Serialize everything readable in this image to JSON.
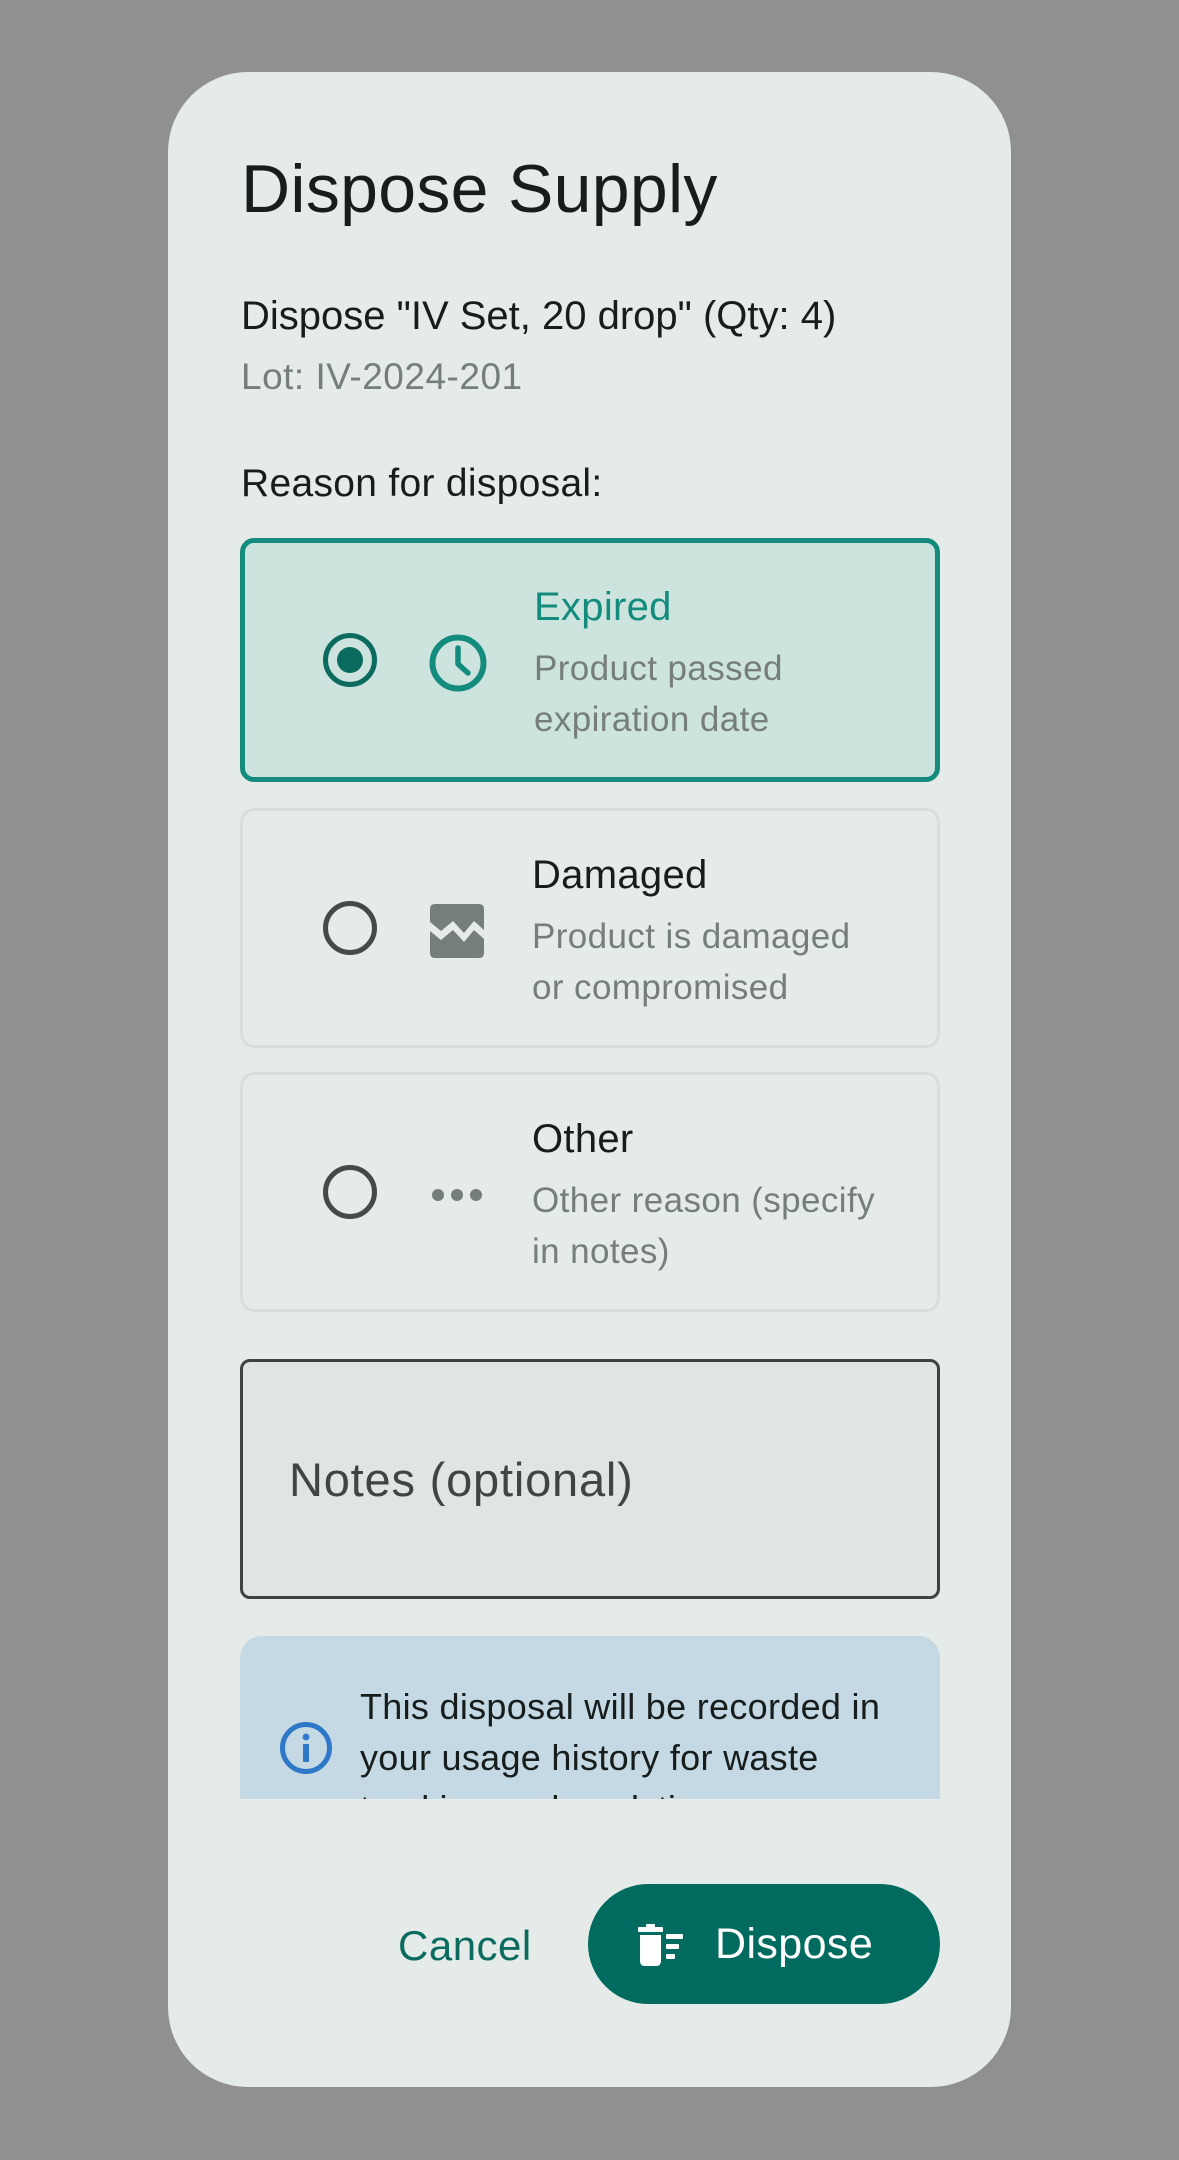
{
  "dialog": {
    "title": "Dispose Supply",
    "subtitle": "Dispose \"IV Set, 20 drop\" (Qty: 4)",
    "lot": "Lot: IV-2024-201",
    "reason_label": "Reason for disposal:"
  },
  "reasons": [
    {
      "title": "Expired",
      "desc": "Product passed expiration date",
      "icon": "clock-icon",
      "selected": true
    },
    {
      "title": "Damaged",
      "desc": "Product is damaged or compromised",
      "icon": "broken-image-icon",
      "selected": false
    },
    {
      "title": "Other",
      "desc": "Other reason (specify in notes)",
      "icon": "more-horiz-icon",
      "selected": false
    }
  ],
  "notes": {
    "placeholder": "Notes (optional)",
    "value": ""
  },
  "info": {
    "icon": "info-icon",
    "text": "This disposal will be recorded in your usage history for waste tracking and analytics."
  },
  "actions": {
    "cancel_label": "Cancel",
    "dispose_label": "Dispose",
    "dispose_icon": "delete-sweep-icon"
  },
  "colors": {
    "accent": "#006b5e",
    "selected_border": "#138b7d",
    "selected_bg": "#cde3de",
    "dialog_bg": "#e4ebe9",
    "info_bg": "#c4d9e3",
    "info_icon": "#2f78c8",
    "scrim": "#909090"
  }
}
